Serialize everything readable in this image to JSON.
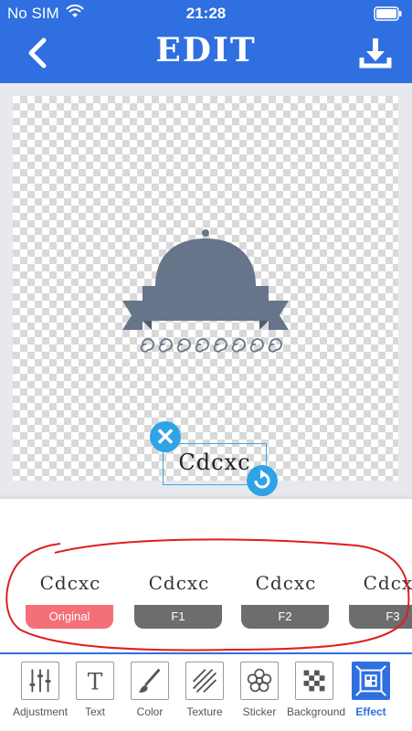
{
  "status_bar": {
    "carrier": "No SIM",
    "time": "21:28"
  },
  "header": {
    "title": "EDIT"
  },
  "canvas": {
    "text_element": "Cdcxc",
    "delete_glyph": "✕"
  },
  "filters": [
    {
      "preview": "Cdcxc",
      "label": "Original"
    },
    {
      "preview": "Cdcxc",
      "label": "F1"
    },
    {
      "preview": "Cdcxc",
      "label": "F2"
    },
    {
      "preview": "Cdcxc",
      "label": "F3"
    }
  ],
  "toolbar": {
    "items": [
      {
        "label": "Adjustment",
        "icon": "sliders-icon"
      },
      {
        "label": "Text",
        "icon": "text-t-icon"
      },
      {
        "label": "Color",
        "icon": "brush-icon"
      },
      {
        "label": "Texture",
        "icon": "diagonal-lines-icon"
      },
      {
        "label": "Sticker",
        "icon": "flower-icon"
      },
      {
        "label": "Background",
        "icon": "checkerboard-icon"
      },
      {
        "label": "Effect",
        "icon": "effect-icon"
      }
    ],
    "active": "Effect"
  },
  "colors": {
    "header_blue": "#2f6fe0",
    "handle_blue": "#2fa3e6",
    "active_filter": "#f56f79",
    "filter_label": "#6d6d6d",
    "logo_gray": "#667589",
    "annotation_red": "#e01e1e"
  }
}
